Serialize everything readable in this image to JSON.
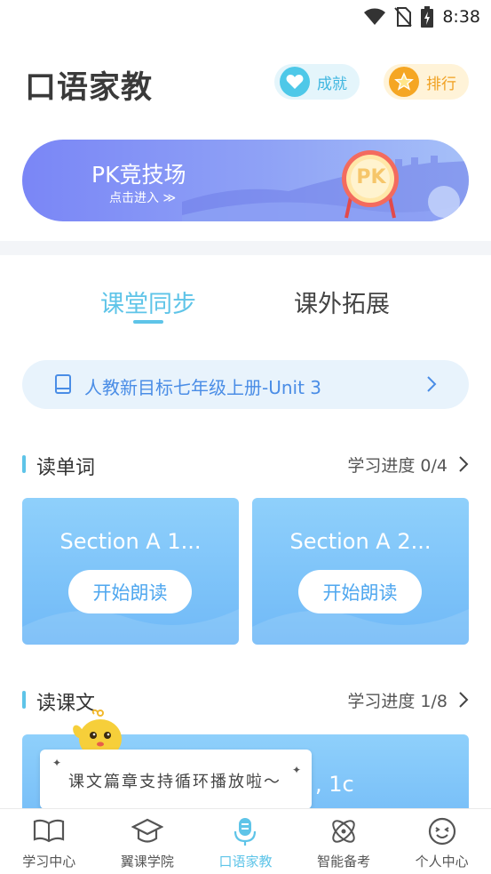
{
  "status_bar": {
    "time": "8:38",
    "icons": [
      "wifi-icon",
      "no-sim-icon",
      "battery-charging-icon"
    ]
  },
  "header": {
    "title": "口语家教",
    "achievement_label": "成就",
    "rank_label": "排行"
  },
  "pk_banner": {
    "title": "PK竞技场",
    "subtitle": "点击进入 ≫",
    "badge": "PK"
  },
  "tabs": [
    {
      "label": "课堂同步",
      "active": true
    },
    {
      "label": "课外拓展",
      "active": false
    }
  ],
  "textbook": {
    "label": "人教新目标七年级上册-Unit 3"
  },
  "read_words": {
    "title": "读单词",
    "progress": "学习进度 0/4",
    "cards": [
      {
        "title": "Section A 1...",
        "button": "开始朗读"
      },
      {
        "title": "Section A 2...",
        "button": "开始朗读"
      }
    ]
  },
  "read_text": {
    "title": "读课文",
    "progress": "学习进度 1/8",
    "card_title": ", 1c",
    "tooltip": "课文篇章支持循环播放啦～"
  },
  "bottom_nav": [
    {
      "label": "学习中心",
      "icon": "book-open-icon",
      "active": false
    },
    {
      "label": "翼课学院",
      "icon": "graduation-cap-icon",
      "active": false
    },
    {
      "label": "口语家教",
      "icon": "microphone-icon",
      "active": true
    },
    {
      "label": "智能备考",
      "icon": "atom-icon",
      "active": false
    },
    {
      "label": "个人中心",
      "icon": "smiley-icon",
      "active": false
    }
  ],
  "colors": {
    "accent": "#5ec4e8",
    "card_blue": "#70b9f7",
    "rank_orange": "#f5a623",
    "banner_purple": "#7a86f6"
  }
}
